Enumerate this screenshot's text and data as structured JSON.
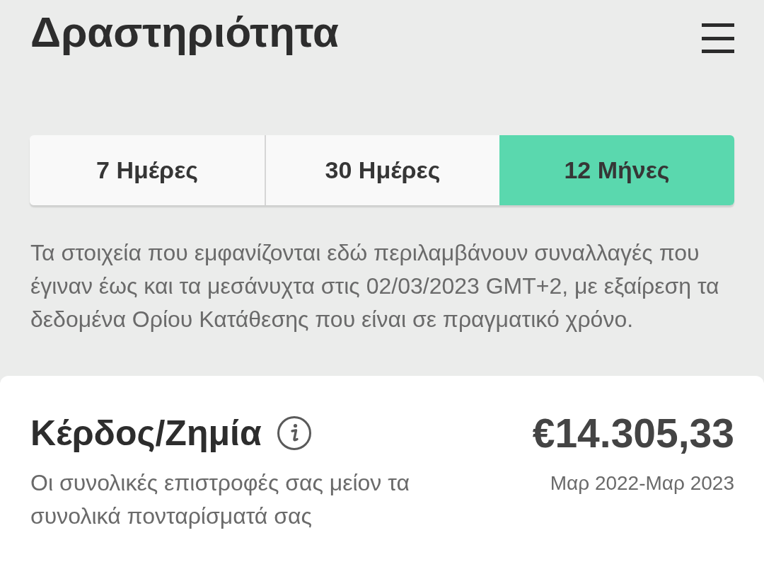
{
  "header": {
    "title": "Δραστηριότητα"
  },
  "tabs": [
    {
      "label": "7 Ημέρες",
      "selected": false
    },
    {
      "label": "30 Ημέρες",
      "selected": false
    },
    {
      "label": "12 Μήνες",
      "selected": true
    }
  ],
  "notice": "Τα στοιχεία που εμφανίζονται εδώ περιλαμβάνουν συναλλαγές που έγιναν έως και τα μεσάνυχτα στις 02/03/2023 GMT+2, με εξαίρεση τα δεδομένα Ορίου Κατάθεσης που είναι σε πραγματικό χρόνο.",
  "profit_loss": {
    "title": "Κέρδος/Ζημία",
    "description": "Οι συνολικές επιστροφές σας μείον τα συνολικά πονταρίσματά σας",
    "amount": "€14.305,33",
    "period": "Μαρ 2022-Μαρ 2023"
  }
}
